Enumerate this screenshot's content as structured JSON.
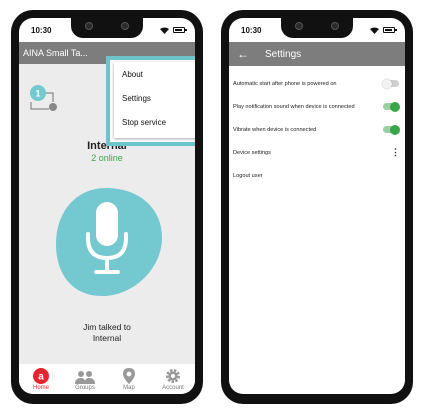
{
  "left_phone": {
    "status": {
      "time": "10:30"
    },
    "appbar": {
      "title": "AINA Small Ta..."
    },
    "menu": {
      "items": [
        "About",
        "Settings",
        "Stop service"
      ]
    },
    "channel": {
      "name": "Internal",
      "online": "2 online"
    },
    "last_talk": {
      "line1": "Jim talked to",
      "line2": "Internal"
    },
    "bottom_nav": [
      {
        "label": "Home",
        "icon": "aina-logo-icon"
      },
      {
        "label": "Groups",
        "icon": "groups-icon"
      },
      {
        "label": "Map",
        "icon": "map-pin-icon"
      },
      {
        "label": "Account",
        "icon": "gear-icon"
      }
    ],
    "colors": {
      "accent": "#e4252b",
      "talk_button": "#74c8cf",
      "highlight": "#6fc4cc",
      "online": "#3aa64a"
    }
  },
  "right_phone": {
    "status": {
      "time": "10:30"
    },
    "header": {
      "title": "Settings"
    },
    "settings": [
      {
        "label": "Automatic start after phone is powered on",
        "control": "toggle",
        "on": false
      },
      {
        "label": "Play notification sound when device is connected",
        "control": "toggle",
        "on": true
      },
      {
        "label": "Vibrate when device is connected",
        "control": "toggle",
        "on": true
      },
      {
        "label": "Device settings",
        "control": "more"
      },
      {
        "label": "Logout user",
        "control": "none"
      }
    ]
  }
}
